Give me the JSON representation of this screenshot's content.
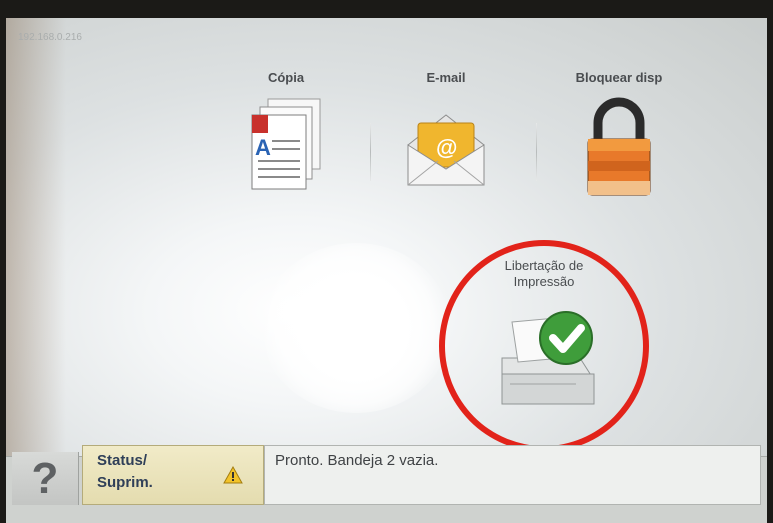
{
  "header": {
    "ip_address": "192.168.0.216"
  },
  "apps": [
    {
      "label": "Cópia",
      "icon": "copy-document-icon"
    },
    {
      "label": "E-mail",
      "icon": "email-envelope-icon"
    },
    {
      "label": "Bloquear disp",
      "icon": "padlock-icon"
    },
    {
      "label": "Libertação de Impressão",
      "icon": "print-release-check-icon"
    }
  ],
  "status_bar": {
    "help_label": "?",
    "status_button": {
      "line1": "Status/",
      "line2": "Suprim."
    },
    "message": "Pronto. Bandeja 2 vazia."
  },
  "colors": {
    "highlight_ring": "#e2231a",
    "status_button_bg": "#efe8c2",
    "warning": "#f2c32a"
  }
}
